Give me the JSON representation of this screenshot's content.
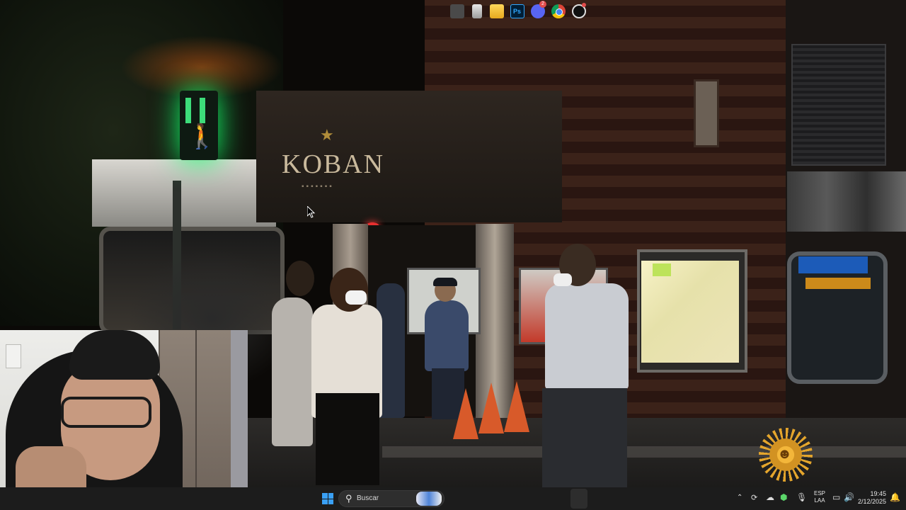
{
  "video": {
    "storefront_sign": "KOBAN",
    "watermark_icon": "sun-logo-icon"
  },
  "taskbar": {
    "search_placeholder": "Buscar",
    "icons": [
      "windows-start-icon",
      "search-icon",
      "tv-app-icon",
      "notes-icon",
      "file-explorer-icon",
      "photoshop-icon",
      "discord-icon",
      "chrome-icon",
      "obs-icon"
    ],
    "ps_label": "Ps",
    "discord_badge": "2"
  },
  "tray": {
    "language_line1": "ESP",
    "language_line2": "LAA",
    "time": "19:45",
    "date": "2/12/2025"
  },
  "colors": {
    "taskbar_bg": "#1c1c1c",
    "accent": "#3aa0f5",
    "signal_green": "#45ff8c"
  }
}
